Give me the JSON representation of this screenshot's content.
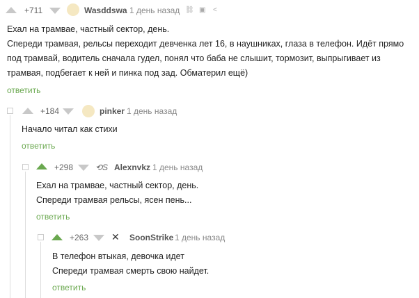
{
  "comments": [
    {
      "rating": "+711",
      "author": "Wasddswa",
      "time": "1 день назад",
      "lines": [
        "Ехал на трамвае, частный сектор, день.",
        "Спереди трамвая, рельсы переходит девченка лет 16, в наушниках, глаза в телефон. Идёт прямо",
        "под трамвай, водитель сначала гудел, понял что баба не слышит, тормозит, выпрыгивает из",
        "трамвая, подбегает к ней и пинка под зад. Обматерил ещё)"
      ],
      "reply": "ответить"
    },
    {
      "rating": "+184",
      "author": "pinker",
      "time": "1 день назад",
      "lines": [
        "Начало читал как стихи"
      ],
      "reply": "ответить"
    },
    {
      "rating": "+298",
      "author": "Alexnvkz",
      "time": "1 день назад",
      "lines": [
        "Ехал на трамвае, частный сектор, день.",
        "Спереди трамвая рельсы, ясен пень..."
      ],
      "reply": "ответить"
    },
    {
      "rating": "+263",
      "author": "SoonStrike",
      "time": "1 день назад",
      "lines": [
        "В телефон втыкая, девочка идет",
        "Спереди трамвая смерть свою найдет."
      ],
      "reply": "ответить"
    }
  ],
  "icons": {
    "link": "link-icon",
    "save": "save-icon",
    "share": "share-icon",
    "collapse": "collapse-icon",
    "upvote": "upvote-icon",
    "downvote": "downvote-icon"
  },
  "colors": {
    "accent": "#6aa84f",
    "vote_idle": "#c8c8c8"
  }
}
